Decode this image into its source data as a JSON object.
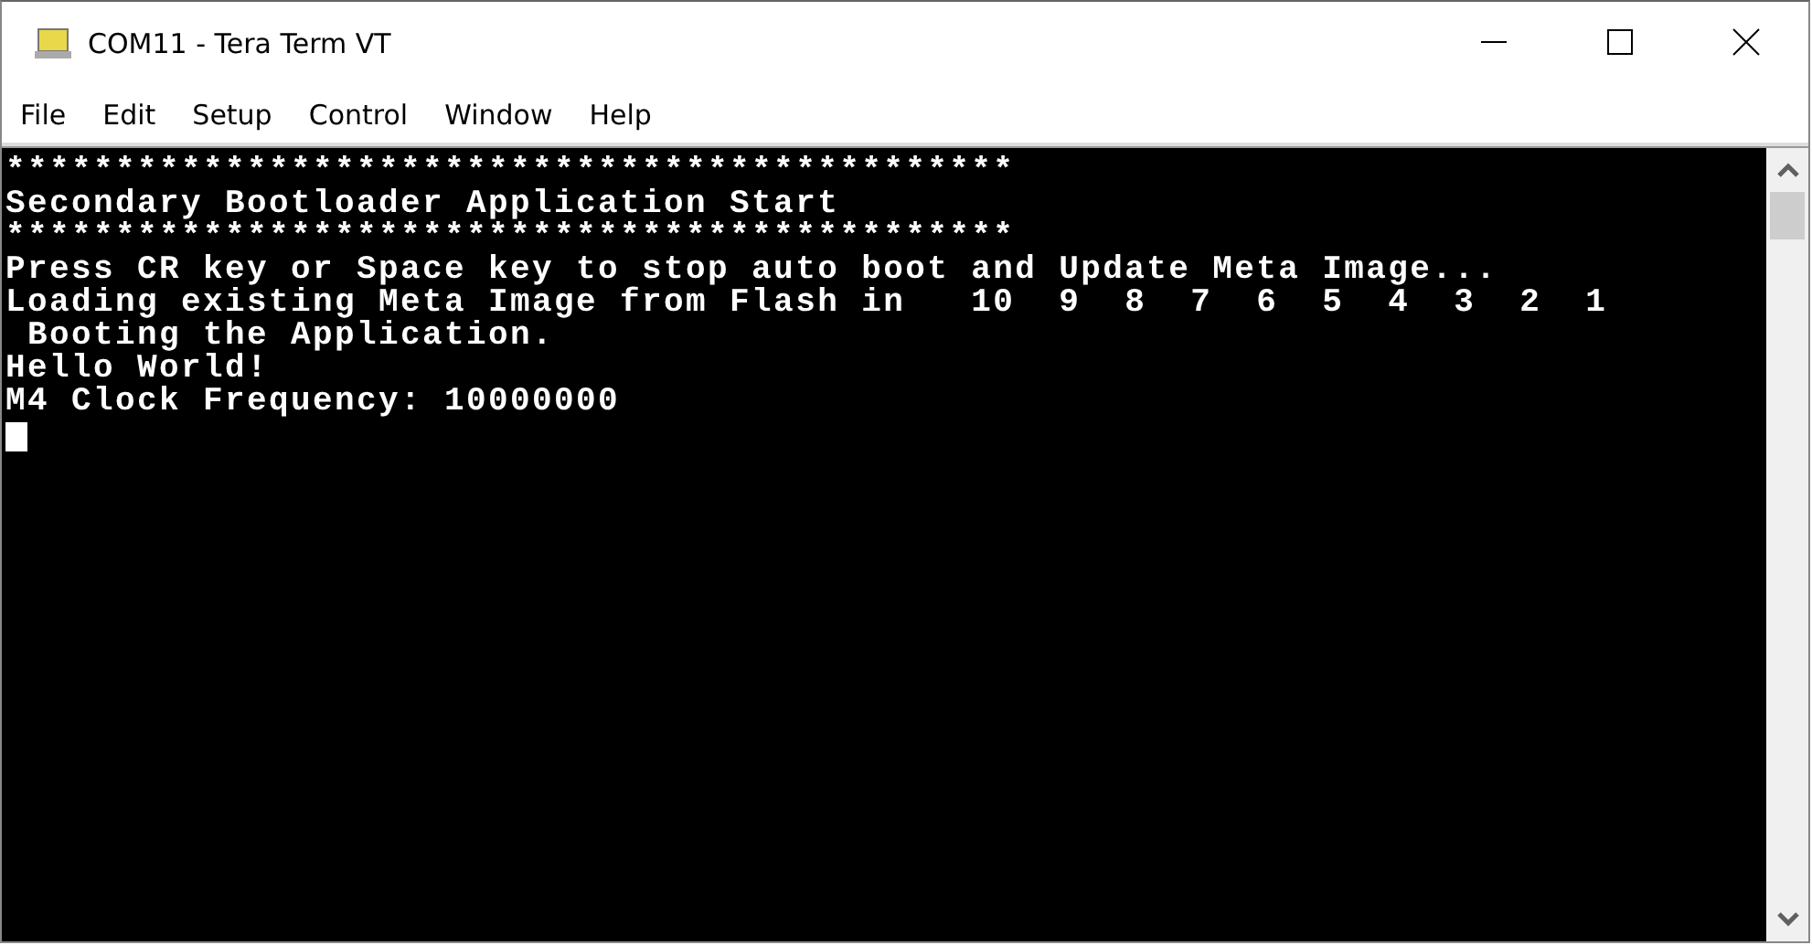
{
  "window": {
    "title": "COM11 - Tera Term VT"
  },
  "menu": [
    "File",
    "Edit",
    "Setup",
    "Control",
    "Window",
    "Help"
  ],
  "terminal": {
    "lines": [
      "**********************************************",
      "Secondary Bootloader Application Start",
      "**********************************************",
      "Press CR key or Space key to stop auto boot and Update Meta Image...",
      "Loading existing Meta Image from Flash in   10  9  8  7  6  5  4  3  2  1",
      " Booting the Application.",
      "Hello World!",
      "M4 Clock Frequency: 10000000"
    ]
  }
}
